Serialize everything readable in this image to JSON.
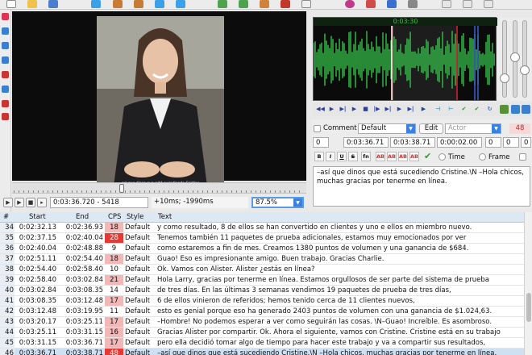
{
  "colors": {
    "wave_green": "#36c24a",
    "selection_bg": "#dde6f3",
    "highlight_row": "#cfe0f3",
    "cps_warn": "#f2b7b7",
    "cps_bad": "#e53935"
  },
  "toolbar": {
    "icons": [
      "new-file-icon",
      "open-file-icon",
      "save-icon",
      "jump-icon",
      "zoom-in-icon",
      "zoom-out-icon",
      "play-video-icon",
      "video-forward-icon",
      "sort-grid-icon",
      "style-manager-icon",
      "fonts-icon",
      "attachments-icon",
      "spell-check-icon",
      "properties-icon",
      "translation-icon",
      "help-icon"
    ]
  },
  "video": {
    "subtitle_line1": "–así que dinos que está sucediendo Cristine.",
    "subtitle_line2": "–Hola chicos, muchas gracias por tenerme en línea."
  },
  "playback": {
    "time_frame": "0:03:36.720 - 5418",
    "offset": "+10ms; -1990ms",
    "zoom": "87.5%"
  },
  "audio": {
    "time_label": "0:03:30"
  },
  "editor": {
    "comment_label": "Comment",
    "style_value": "Default",
    "edit_button": "Edit",
    "actor_placeholder": "Actor",
    "cps_value": "48",
    "layer": "0",
    "start_time": "0:03:36.71",
    "end_time": "0:03:38.71",
    "duration": "0:00:02.00",
    "margin_l": "0",
    "margin_r": "0",
    "margin_v": "0",
    "fmt_buttons": [
      "B",
      "I",
      "U",
      "S",
      "fn",
      "AB",
      "AB",
      "AB",
      "AB"
    ],
    "time_radio": "Time",
    "frame_radio": "Frame",
    "text": "–así que dinos que está sucediendo Cristine.\\N –Hola chicos, muchas gracias por tenerme en línea."
  },
  "grid": {
    "headers": {
      "num": "#",
      "start": "Start",
      "end": "End",
      "cps": "CPS",
      "style": "Style",
      "text": "Text"
    },
    "rows": [
      {
        "num": "34",
        "start": "0:02:32.13",
        "end": "0:02:36.93",
        "cps": "18",
        "style": "Default",
        "text": " y como resultado, 8 de ellos se han convertido en clientes y uno e ellos en miembro nuevo."
      },
      {
        "num": "35",
        "start": "0:02:37.15",
        "end": "0:02:40.04",
        "cps": "28",
        "style": "Default",
        "text": "Tenemos también 11 paquetes de prueba adicionales, estamos muy emocionados por ver"
      },
      {
        "num": "36",
        "start": "0:02:40.04",
        "end": "0:02:48.88",
        "cps": "9",
        "style": "Default",
        "text": "como estaremos a fin de mes. Creamos 1380 puntos de volumen y una ganancia de $684."
      },
      {
        "num": "37",
        "start": "0:02:51.11",
        "end": "0:02:54.40",
        "cps": "18",
        "style": "Default",
        "text": "Guao! Eso es impresionante amigo. Buen trabajo. Gracias Charlie."
      },
      {
        "num": "38",
        "start": "0:02:54.40",
        "end": "0:02:58.40",
        "cps": "10",
        "style": "Default",
        "text": "Ok. Vamos con Alister. Alister ¿estás en línea?"
      },
      {
        "num": "39",
        "start": "0:02:58.40",
        "end": "0:03:02.84",
        "cps": "21",
        "style": "Default",
        "text": "Hola Larry, gracias por tenerme en línea. Estamos orgullosos de ser parte del sistema de prueba"
      },
      {
        "num": "40",
        "start": "0:03:02.84",
        "end": "0:03:08.35",
        "cps": "14",
        "style": "Default",
        "text": "de tres días. En las últimas 3 semanas vendimos 19 paquetes de prueba de tres días,"
      },
      {
        "num": "41",
        "start": "0:03:08.35",
        "end": "0:03:12.48",
        "cps": "17",
        "style": "Default",
        "text": "6 de ellos vinieron de referidos; hemos tenido cerca de 11 clientes nuevos,"
      },
      {
        "num": "42",
        "start": "0:03:12.48",
        "end": "0:03:19.95",
        "cps": "11",
        "style": "Default",
        "text": "esto es genial porque eso ha generado 2403 puntos de volumen con una ganancia de $1.024,63."
      },
      {
        "num": "43",
        "start": "0:03:20.17",
        "end": "0:03:25.11",
        "cps": "17",
        "style": "Default",
        "text": "–Hombre! No podemos esperar a ver como seguirán las cosas. \\N–Guao! Increíble. Es asombroso."
      },
      {
        "num": "44",
        "start": "0:03:25.11",
        "end": "0:03:31.15",
        "cps": "16",
        "style": "Default",
        "text": "Gracias Alister por compartir. Ok. Ahora el siguiente, vamos con Cristine. Cristine está en su trabajo"
      },
      {
        "num": "45",
        "start": "0:03:31.15",
        "end": "0:03:36.71",
        "cps": "17",
        "style": "Default",
        "text": "pero ella decidió tomar algo de tiempo para hacer este trabajo y va a compartir sus resultados,"
      },
      {
        "num": "46",
        "start": "0:03:36.71",
        "end": "0:03:38.71",
        "cps": "48",
        "style": "Default",
        "text": "–así que dinos que está sucediendo Cristine.\\N –Hola chicos, muchas gracias por tenerme en línea."
      }
    ]
  }
}
